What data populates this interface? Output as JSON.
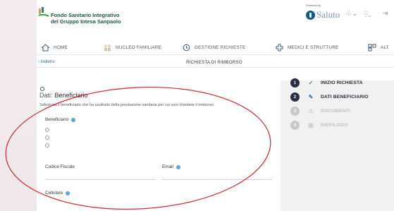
{
  "brand": {
    "line1": "Fondo Sanitario Integrativo",
    "line2": "del Gruppo Intesa Sanpaolo",
    "powered_by": "Powered by",
    "partner_name": "Saluto"
  },
  "nav": {
    "items": [
      {
        "label": "HOME",
        "icon": "house-icon"
      },
      {
        "label": "NUCLEO FAMILIARE",
        "icon": "family-icon"
      },
      {
        "label": "GESTIONE RICHIESTE",
        "icon": "requests-icon"
      },
      {
        "label": "MEDICI E STRUTTURE",
        "icon": "hospital-icon"
      },
      {
        "label": "ALT",
        "icon": "grid-icon"
      }
    ]
  },
  "breadcrumb": {
    "back": "‹ Indietro",
    "title": "RICHIESTA DI RIMBORSO"
  },
  "form": {
    "title_prefix": "Dati:",
    "title": "Beneficiario",
    "subtitle": "Seleziona il beneficiario che ha usufruito della prestazione sanitaria per cui vuoi chiedere il rimborso.",
    "beneficiary_label": "Beneficiario",
    "fiscal_code_label": "Codice Fiscale",
    "email_label": "Email",
    "mobile_label": "Cellulare"
  },
  "steps": [
    {
      "num": "1",
      "label": "INIZIO RICHIESTA",
      "mark": "✓",
      "state": "active"
    },
    {
      "num": "2",
      "label": "DATI BENEFICIARIO",
      "mark": "✎",
      "state": "active"
    },
    {
      "num": "3",
      "label": "DOCUMENTI",
      "mark": "⚠",
      "state": "inactive"
    },
    {
      "num": "4",
      "label": "RIEPILOGO",
      "mark": "▤",
      "state": "inactive"
    }
  ],
  "colors": {
    "accent": "#2a2f45",
    "link": "#2a6f8e",
    "info": "#5ea6d6",
    "annotation": "#d9242b"
  }
}
